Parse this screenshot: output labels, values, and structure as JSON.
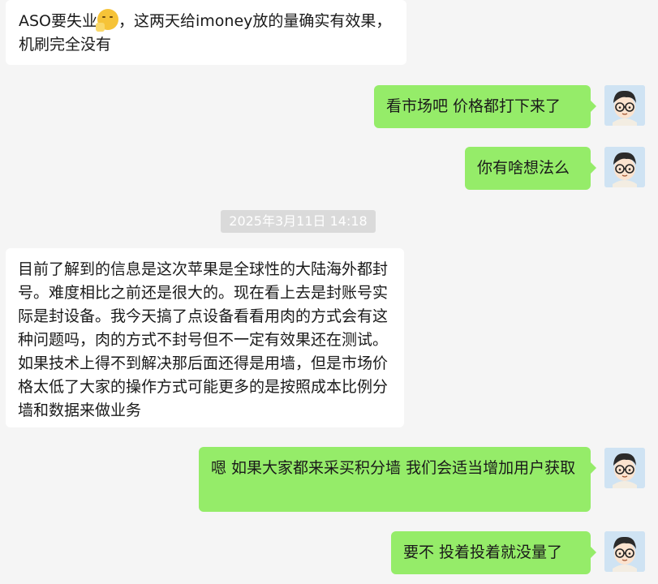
{
  "chat": {
    "messages": [
      {
        "side": "in",
        "text_before_emoji": "ASO要失业",
        "emoji": "shushing-face-icon",
        "text_after_emoji": "，这两天给imoney放的量确实有效果，机刷完全没有"
      },
      {
        "side": "out",
        "text": "看市场吧 价格都打下来了"
      },
      {
        "side": "out",
        "text": "你有啥想法么"
      },
      {
        "side": "in",
        "text": "目前了解到的信息是这次苹果是全球性的大陆海外都封号。难度相比之前还是很大的。现在看上去是封账号实际是封设备。我今天搞了点设备看看用肉的方式会有这种问题吗，肉的方式不封号但不一定有效果还在测试。如果技术上得不到解决那后面还得是用墙，但是市场价格太低了大家的操作方式可能更多的是按照成本比例分墙和数据来做业务"
      },
      {
        "side": "out",
        "text": "嗯 如果大家都来采买积分墙 我们会适当增加用户获取"
      },
      {
        "side": "out",
        "text": "要不 投着投着就没量了"
      }
    ],
    "timestamp": "2025年3月11日 14:18",
    "colors": {
      "background": "#f5f5f5",
      "incoming_bubble": "#ffffff",
      "outgoing_bubble": "#95ec69",
      "timestamp_bg": "#dadada"
    },
    "avatar_icon": "cartoon-boy-with-glasses-avatar-icon"
  }
}
